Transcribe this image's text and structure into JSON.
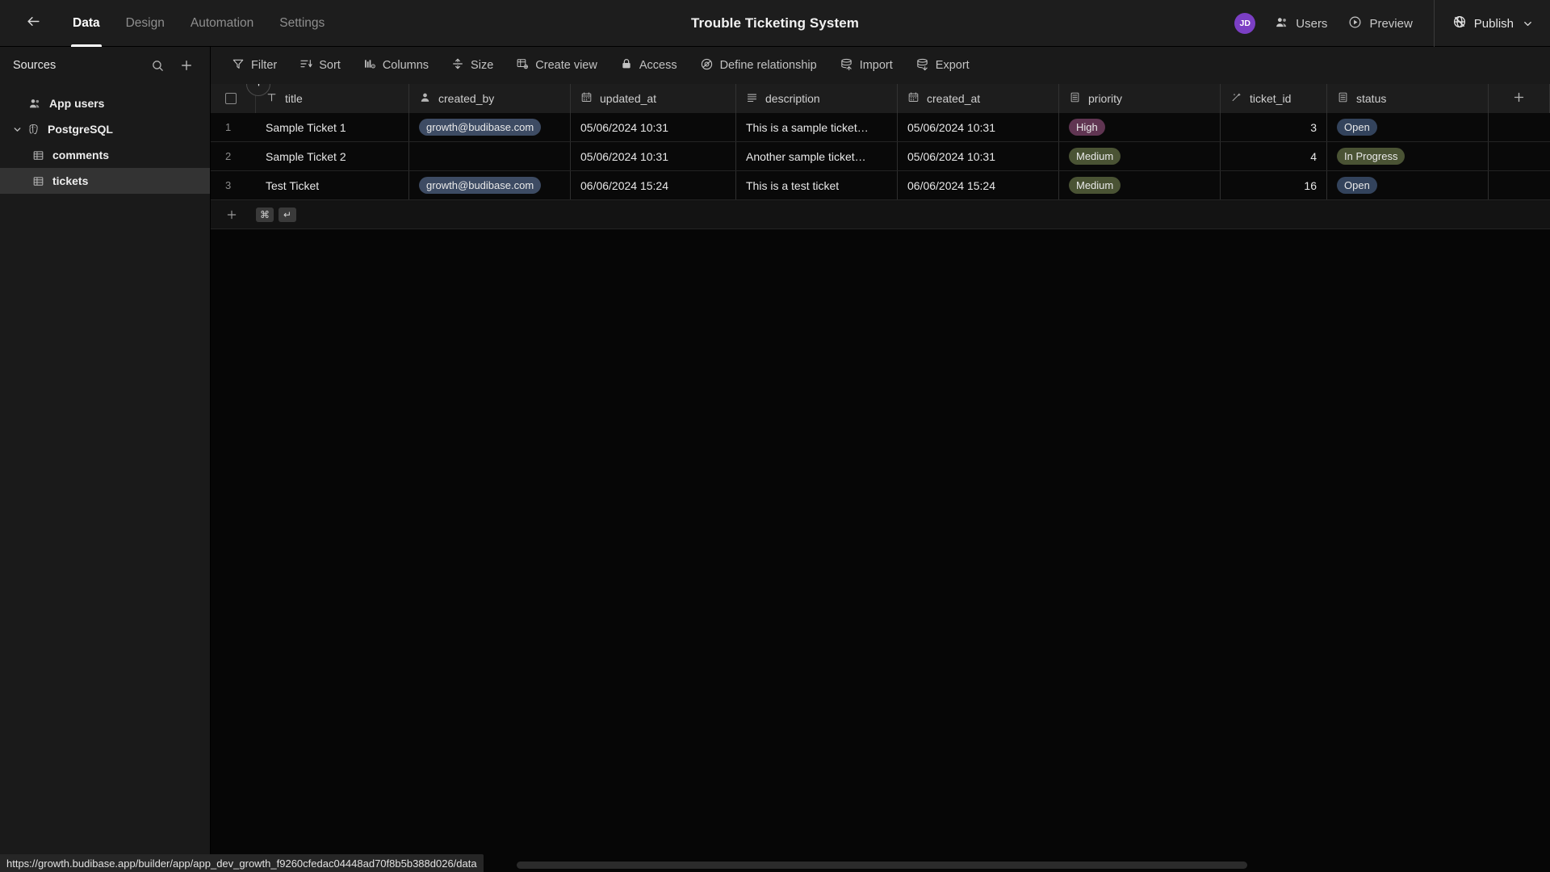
{
  "topbar": {
    "back_icon": "arrow-left-icon",
    "tabs": [
      {
        "label": "Data",
        "active": true
      },
      {
        "label": "Design",
        "active": false
      },
      {
        "label": "Automation",
        "active": false
      },
      {
        "label": "Settings",
        "active": false
      }
    ],
    "app_title": "Trouble Ticketing System",
    "avatar_initials": "JD",
    "avatar_color": "#7b3fc4",
    "users_label": "Users",
    "preview_label": "Preview",
    "publish_label": "Publish"
  },
  "sidebar": {
    "title": "Sources",
    "search_icon": "search-icon",
    "add_icon": "plus-icon",
    "items": [
      {
        "label": "App users",
        "icon": "users-icon",
        "level": 1,
        "selected": false,
        "expandable": false
      },
      {
        "label": "PostgreSQL",
        "icon": "postgres-icon",
        "level": 0,
        "selected": false,
        "expandable": true
      },
      {
        "label": "comments",
        "icon": "table-icon",
        "level": 2,
        "selected": false,
        "expandable": false
      },
      {
        "label": "tickets",
        "icon": "table-icon",
        "level": 2,
        "selected": true,
        "expandable": false
      }
    ]
  },
  "toolbar": {
    "buttons": [
      {
        "label": "Filter",
        "icon": "filter-icon"
      },
      {
        "label": "Sort",
        "icon": "sort-icon"
      },
      {
        "label": "Columns",
        "icon": "columns-icon"
      },
      {
        "label": "Size",
        "icon": "size-icon"
      },
      {
        "label": "Create view",
        "icon": "create-view-icon"
      },
      {
        "label": "Access",
        "icon": "lock-icon"
      },
      {
        "label": "Define relationship",
        "icon": "relationship-icon"
      },
      {
        "label": "Import",
        "icon": "import-icon"
      },
      {
        "label": "Export",
        "icon": "export-icon"
      }
    ]
  },
  "grid": {
    "columns": [
      {
        "key": "title",
        "label": "title",
        "icon": "text-type-icon"
      },
      {
        "key": "created_by",
        "label": "created_by",
        "icon": "user-type-icon"
      },
      {
        "key": "updated_at",
        "label": "updated_at",
        "icon": "date-type-icon"
      },
      {
        "key": "description",
        "label": "description",
        "icon": "longform-type-icon"
      },
      {
        "key": "created_at",
        "label": "created_at",
        "icon": "date-type-icon"
      },
      {
        "key": "priority",
        "label": "priority",
        "icon": "options-type-icon"
      },
      {
        "key": "ticket_id",
        "label": "ticket_id",
        "icon": "formula-type-icon"
      },
      {
        "key": "status",
        "label": "status",
        "icon": "options-type-icon"
      }
    ],
    "add_column_icon": "plus-icon",
    "rows": [
      {
        "num": "1",
        "title": "Sample Ticket 1",
        "created_by": "growth@budibase.com",
        "updated_at": "05/06/2024 10:31",
        "description": "This is a sample ticket…",
        "created_at": "05/06/2024 10:31",
        "priority": "High",
        "priority_style": "pill-high",
        "ticket_id": "3",
        "status": "Open",
        "status_style": "pill-open"
      },
      {
        "num": "2",
        "title": "Sample Ticket 2",
        "created_by": "",
        "updated_at": "05/06/2024 10:31",
        "description": "Another sample ticket…",
        "created_at": "05/06/2024 10:31",
        "priority": "Medium",
        "priority_style": "pill-medium",
        "ticket_id": "4",
        "status": "In Progress",
        "status_style": "pill-prog"
      },
      {
        "num": "3",
        "title": "Test Ticket",
        "created_by": "growth@budibase.com",
        "updated_at": "06/06/2024 15:24",
        "description": "This is a test ticket",
        "created_at": "06/06/2024 15:24",
        "priority": "Medium",
        "priority_style": "pill-medium",
        "ticket_id": "16",
        "status": "Open",
        "status_style": "pill-open"
      }
    ],
    "new_row": {
      "plus_icon": "plus-icon",
      "kbd_cmd": "⌘",
      "kbd_enter": "↵"
    },
    "insert_row_icon": "plus-circle-icon"
  },
  "statusbar": {
    "url": "https://growth.budibase.app/builder/app/app_dev_growth_f9260cfedac04448ad70f8b5b388d026/data"
  }
}
